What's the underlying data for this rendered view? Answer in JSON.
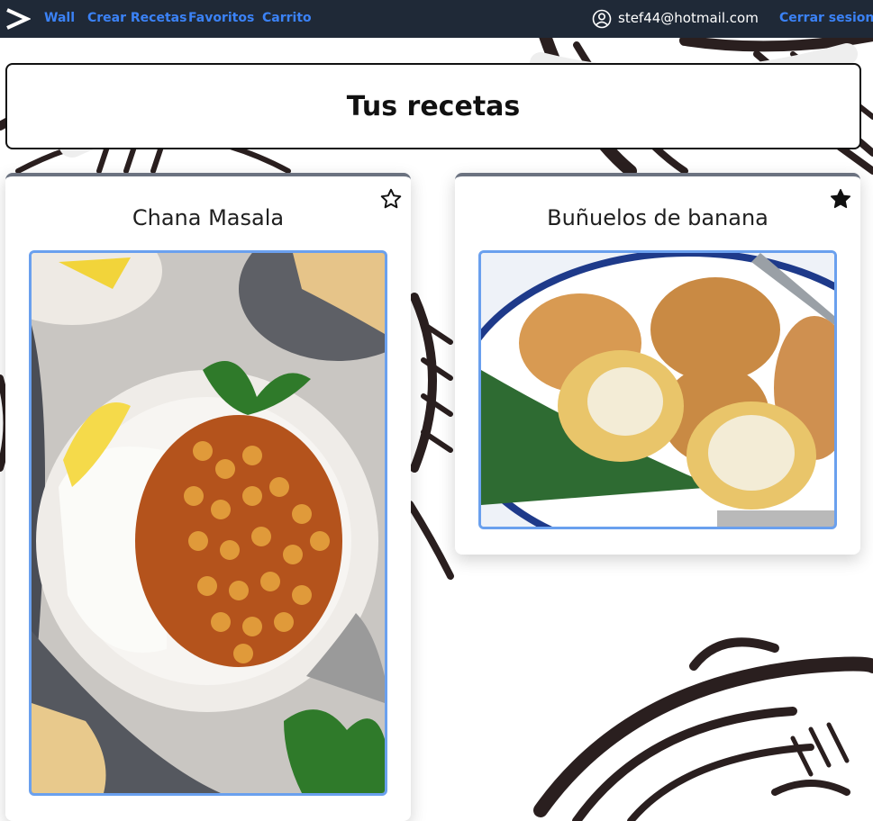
{
  "navbar": {
    "logo_icon": "chevron-right-logo-icon",
    "links": [
      "Wall",
      "Crear Recetas",
      "Favoritos",
      "Carrito"
    ],
    "user_icon": "user-circle-icon",
    "user_email": "stef44@hotmail.com",
    "logout_label": "Cerrar sesion"
  },
  "page": {
    "title": "Tus recetas"
  },
  "recipes": [
    {
      "title": "Chana Masala",
      "favorite": false,
      "star_icon": "star-outline-icon"
    },
    {
      "title": "Buñuelos de banana",
      "favorite": true,
      "star_icon": "star-filled-icon"
    }
  ],
  "colors": {
    "navbar_bg": "#1f2937",
    "link": "#3b82f6",
    "image_border": "#6aa0ee",
    "card_top_border": "#6b7280"
  }
}
